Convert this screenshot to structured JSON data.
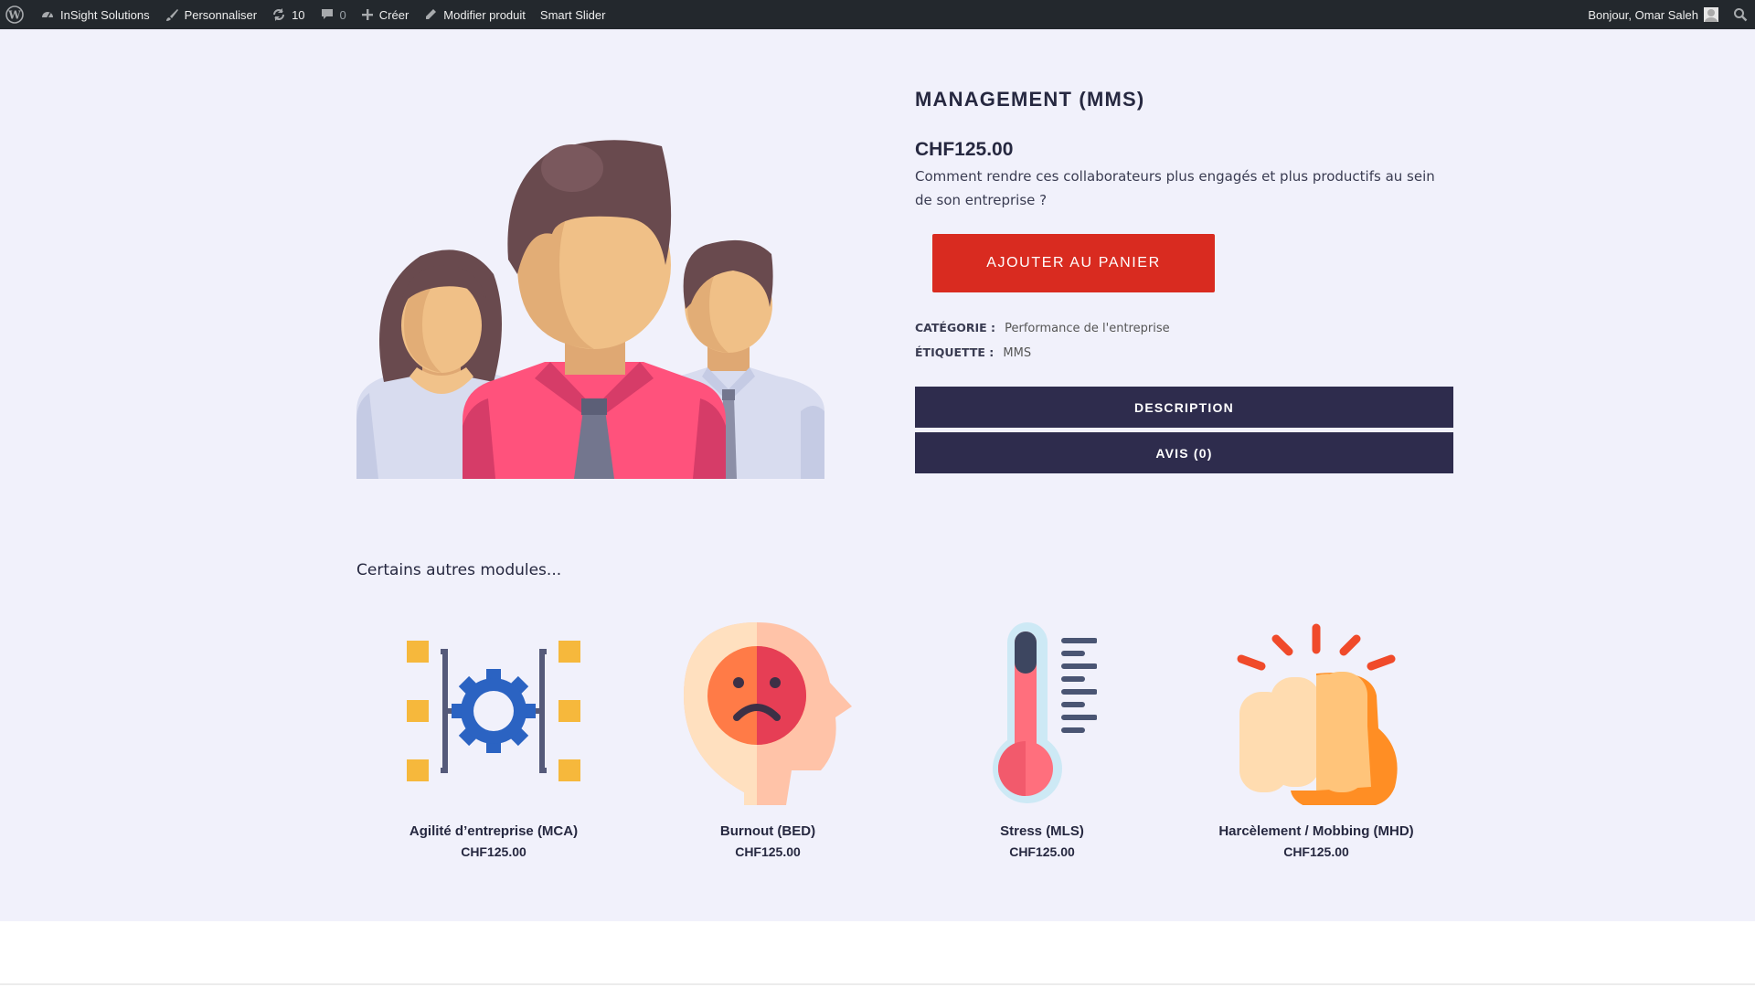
{
  "admin_bar": {
    "site_name": "InSight Solutions",
    "customize": "Personnaliser",
    "updates_count": "10",
    "comments_count": "0",
    "new": "Créer",
    "edit_product": "Modifier produit",
    "smart_slider": "Smart Slider",
    "greeting": "Bonjour, Omar Saleh"
  },
  "product": {
    "title": "MANAGEMENT (MMS)",
    "price": "CHF125.00",
    "short_description": "Comment rendre ces collaborateurs plus engagés et plus productifs au sein de son entreprise ?",
    "add_to_cart": "AJOUTER AU PANIER",
    "category_label": "CATÉGORIE :",
    "category_value": "Performance de l'entreprise",
    "tag_label": "ÉTIQUETTE :",
    "tag_value": "MMS",
    "tabs": [
      {
        "label": "DESCRIPTION"
      },
      {
        "label": "AVIS (0)"
      }
    ]
  },
  "related": {
    "title": "Certains autres modules...",
    "items": [
      {
        "name": "Agilité d’entreprise (MCA)",
        "price": "CHF125.00",
        "icon": "gear-network-icon"
      },
      {
        "name": "Burnout (BED)",
        "price": "CHF125.00",
        "icon": "sad-head-icon"
      },
      {
        "name": "Stress (MLS)",
        "price": "CHF125.00",
        "icon": "thermometer-icon"
      },
      {
        "name": "Harcèlement / Mobbing (MHD)",
        "price": "CHF125.00",
        "icon": "fist-icon"
      }
    ]
  },
  "colors": {
    "page_bg": "#f1f1fb",
    "admin_bar": "#23282d",
    "add_to_cart": "#d92b20",
    "tab_bg": "#2e2c4d",
    "text": "#262840"
  }
}
